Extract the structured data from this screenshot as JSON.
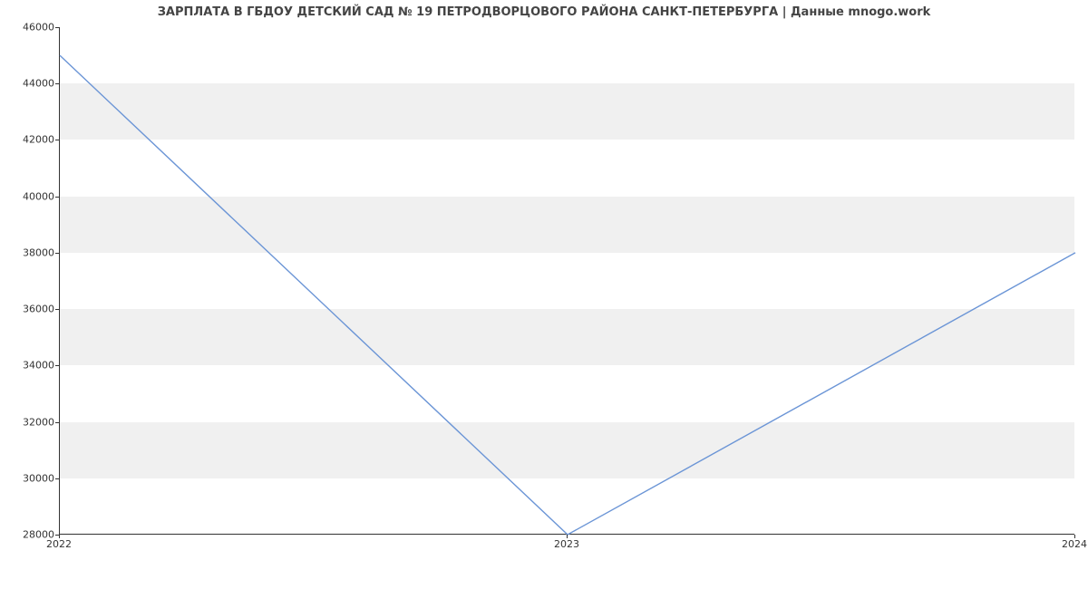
{
  "chart_data": {
    "type": "line",
    "title": "ЗАРПЛАТА В ГБДОУ ДЕТСКИЙ САД № 19 ПЕТРОДВОРЦОВОГО РАЙОНА САНКТ-ПЕТЕРБУРГА | Данные mnogo.work",
    "x": [
      "2022",
      "2023",
      "2024"
    ],
    "values": [
      45000,
      28000,
      38000
    ],
    "y_ticks": [
      28000,
      30000,
      32000,
      34000,
      36000,
      38000,
      40000,
      42000,
      44000,
      46000
    ],
    "x_tick_labels": [
      "2022",
      "2023",
      "2024"
    ],
    "ylim": [
      28000,
      46000
    ],
    "xlabel": "",
    "ylabel": "",
    "line_color": "#6b95d6",
    "band_color": "#f0f0f0"
  }
}
